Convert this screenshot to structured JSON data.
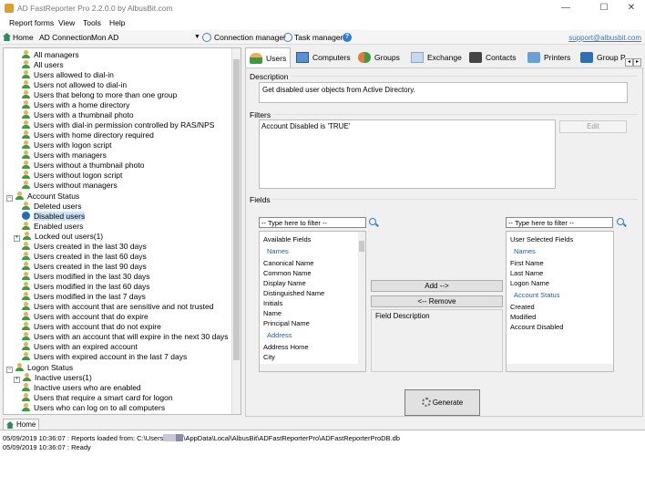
{
  "window": {
    "title": "AD FastReporter Pro 2.2.0.0 by AlbusBit.com",
    "minimize": "—",
    "maximize": "☐",
    "close": "✕"
  },
  "menu": [
    "Report forms",
    "View",
    "Tools",
    "Help"
  ],
  "toolbar": {
    "home": "Home",
    "ad_connection_label": "AD Connection:",
    "ad_connection_value": "Mon AD",
    "connection_manager": "Connection manager",
    "task_manager": "Task manager",
    "help": "?",
    "support_link": "support@albusbit.com"
  },
  "tree": {
    "user_items": [
      "All managers",
      "All users",
      "Users allowed to dial-in",
      "Users not allowed to dial-in",
      "Users that belong to more than one group",
      "Users with a home directory",
      "Users with a thumbnail photo",
      "Users with dial-in permission controlled by RAS/NPS",
      "Users with home directory required",
      "Users with logon script",
      "Users with managers",
      "Users without a thumbnail photo",
      "Users without logon script",
      "Users without managers"
    ],
    "account_status": {
      "label": "Account Status",
      "items": [
        "Deleted users",
        "Disabled users",
        "Enabled users",
        "Locked out users(1)",
        "Users created in the last 30 days",
        "Users created in the last 60 days",
        "Users created in the last 90 days",
        "Users modified in the last 30 days",
        "Users modified in the last 60 days",
        "Users modified in the last 7 days",
        "Users with account that are sensitive and not trusted",
        "Users with account that do expire",
        "Users with account that do not expire",
        "Users with an account that will expire in the next 30 days",
        "Users with an expired account",
        "Users with expired account in the last 7 days"
      ]
    },
    "logon_status": {
      "label": "Logon Status",
      "items": [
        "Inactive users(1)",
        "Inactive users who are enabled",
        "Users that require a smart card for logon",
        "Users who can log on to all computers"
      ]
    }
  },
  "tabs": [
    "Users",
    "Computers",
    "Groups",
    "Exchange",
    "Contacts",
    "Printers",
    "Group P"
  ],
  "tab_nav": {
    "left": "◂",
    "right": "▸"
  },
  "description": {
    "label": "Description",
    "text": "Get disabled user objects from Active Directory."
  },
  "filters": {
    "label": "Filters",
    "text": "Account Disabled is 'TRUE'",
    "edit_button": "Edit"
  },
  "fields": {
    "label": "Fields",
    "filter_placeholder": "-- Type here to filter --",
    "available": {
      "title": "Available Fields",
      "groups": [
        {
          "name": "Names",
          "items": [
            "Canonical Name",
            "Common Name",
            "Display Name",
            "Distinguished Name",
            "Initials",
            "Name",
            "Principal Name"
          ]
        },
        {
          "name": "Address",
          "items": [
            "Address Home",
            "City"
          ]
        }
      ]
    },
    "selected": {
      "title": "User Selected Fields",
      "groups": [
        {
          "name": "Names",
          "items": [
            "First Name",
            "Last Name",
            "Logon Name"
          ]
        },
        {
          "name": "Account Status",
          "items": [
            "Created",
            "Modified",
            "Account Disabled"
          ]
        }
      ]
    },
    "add_button": "Add -->",
    "remove_button": "<-- Remove",
    "field_description_label": "Field Description"
  },
  "generate_button": "Generate",
  "bottom_tab": "Home",
  "log": {
    "line1_prefix": "05/09/2019 10:36:07 : Reports loaded from: C:\\Users",
    "line1_suffix": "\\AppData\\Local\\AlbusBit\\ADFastReporterPro\\ADFastReporterProDB.db",
    "line2": "05/09/2019 10:36:07 : Ready"
  }
}
